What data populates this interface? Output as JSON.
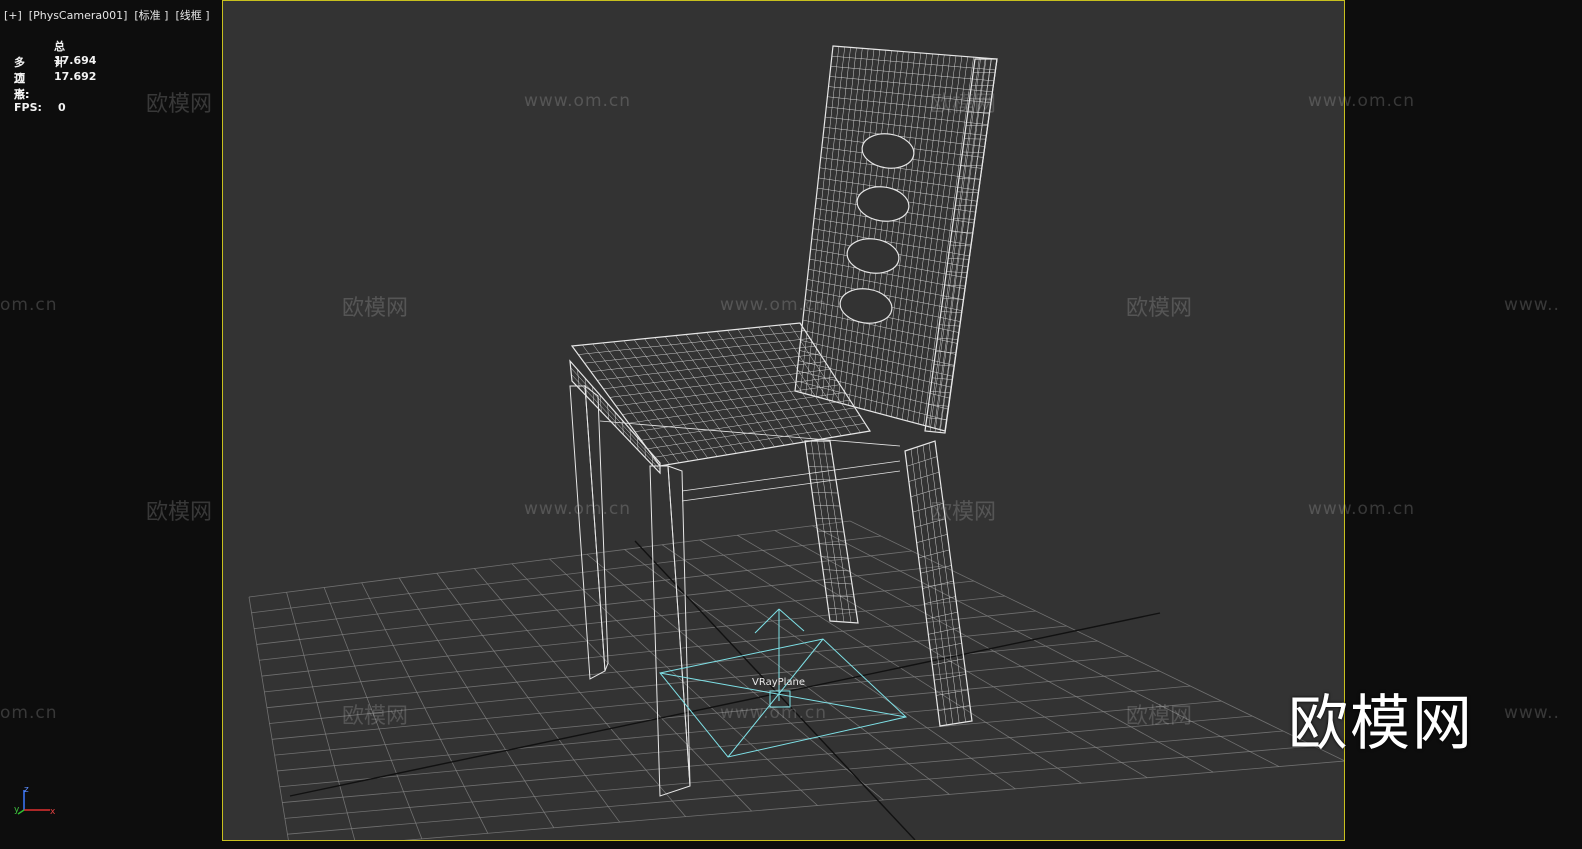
{
  "viewport_label": "[+]  [PhysCamera001]  [标准 ]  [线框 ]",
  "stats": {
    "header": "总计",
    "polygons_label": "多边形:",
    "polygons_value": "17.694",
    "vertices_label": "顶点:",
    "vertices_value": "17.692",
    "fps_label": "FPS:",
    "fps_value": "0"
  },
  "scene": {
    "object_label": "VRayPlane",
    "grid_color": "#8a8a8a",
    "wire_color": "#e6e6e6",
    "gizmo_color": "#7ee0e6",
    "viewport_border_color": "#c8c01e"
  },
  "axis_tripod": {
    "x": "x",
    "y": "y",
    "z": "z"
  },
  "watermarks": {
    "cn": "欧模网",
    "url": "www.om.cn",
    "url_partial": "om.cn",
    "url_partial_right": "www.."
  },
  "logo": "欧模网"
}
